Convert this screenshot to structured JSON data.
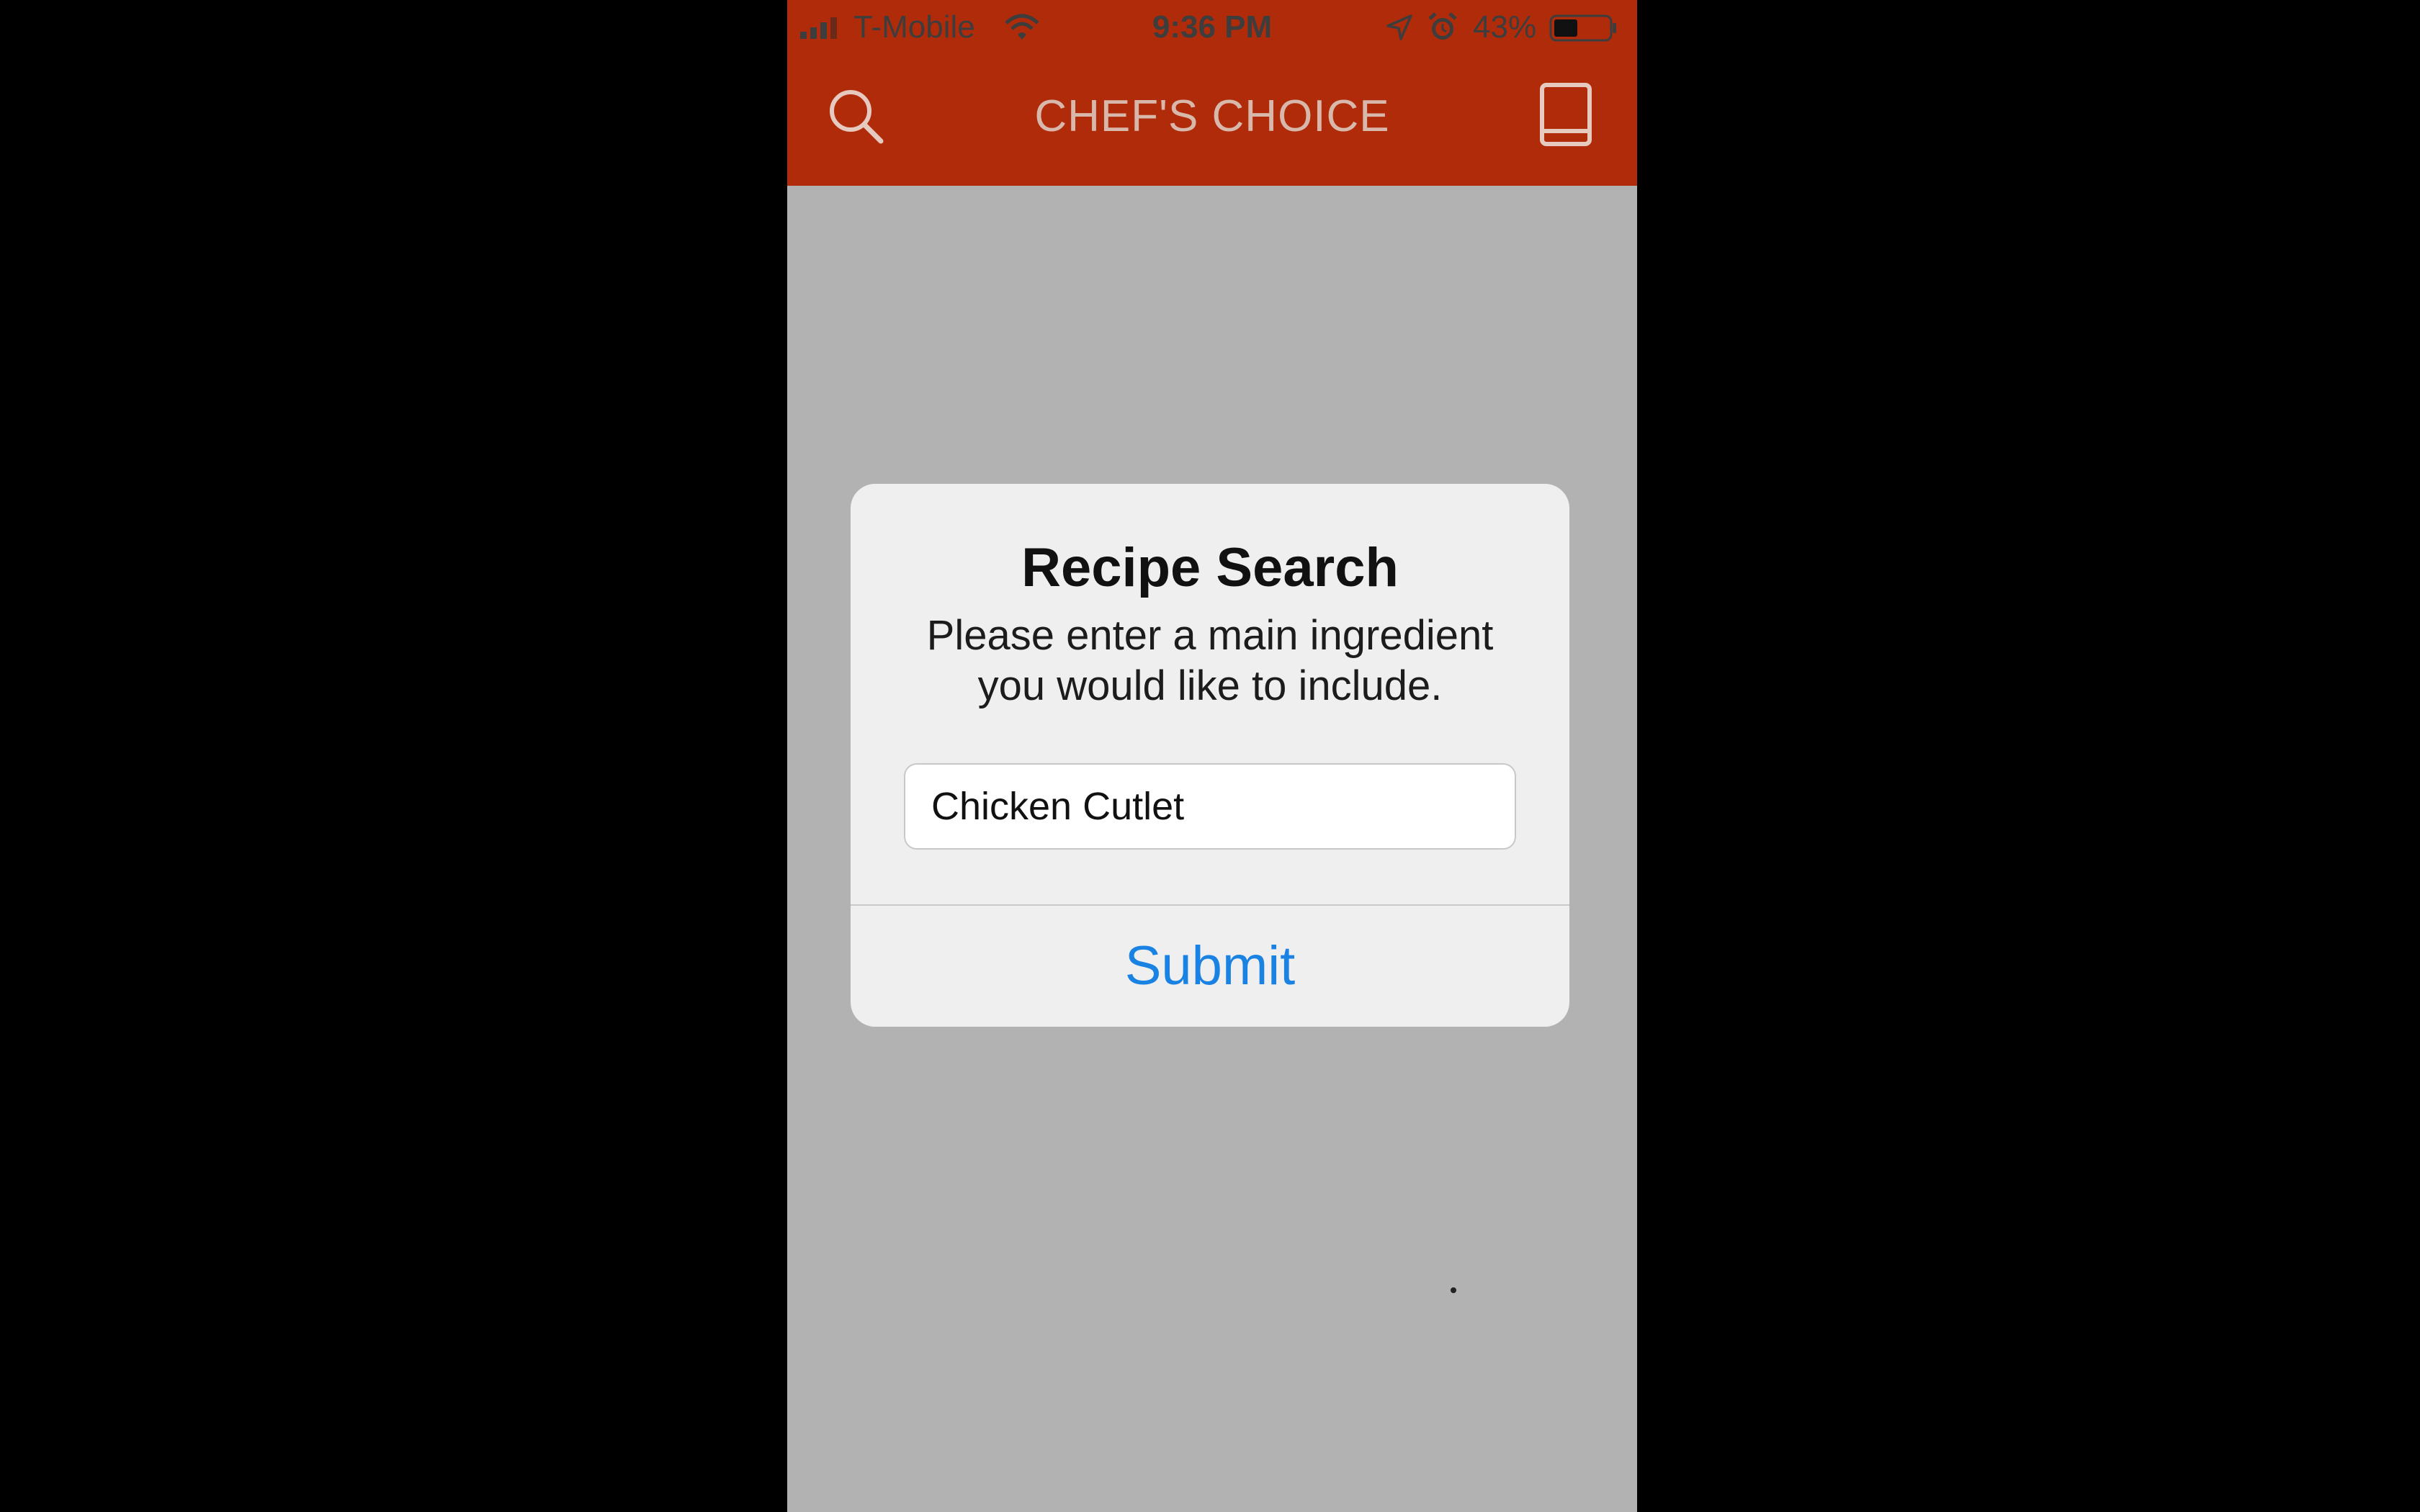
{
  "status_bar": {
    "carrier": "T-Mobile",
    "time": "9:36 PM",
    "battery_percent": "43%",
    "battery_level": 0.43,
    "signal_icon": "signal-bars-icon",
    "wifi_icon": "wifi-icon",
    "location_icon": "location-arrow-icon",
    "alarm_icon": "alarm-clock-icon",
    "battery_icon": "battery-icon"
  },
  "nav_bar": {
    "title": "CHEF'S CHOICE",
    "search_icon": "search-icon",
    "book_icon": "book-icon",
    "background_color": "#b02b0a"
  },
  "dialog": {
    "title": "Recipe Search",
    "message": "Please enter a main ingredient you would like to include.",
    "input_value": "Chicken Cutlet",
    "submit_label": "Submit",
    "accent_color": "#1a82e3"
  },
  "background_color": "#b2b2b2"
}
